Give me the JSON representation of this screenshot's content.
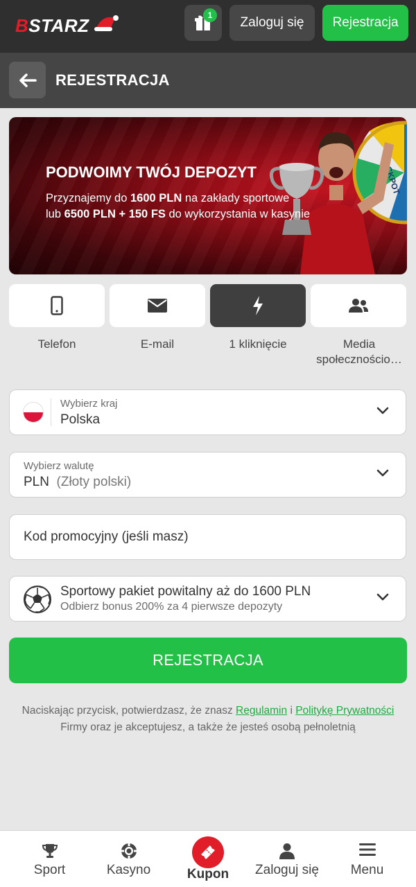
{
  "header": {
    "logo_text": "BSTARZ",
    "gift_badge": "1",
    "login_label": "Zaloguj się",
    "register_label": "Rejestracja"
  },
  "subheader": {
    "title": "REJESTRACJA"
  },
  "banner": {
    "title": "PODWOIMY TWÓJ DEPOZYT",
    "line1_pre": "Przyznajemy do ",
    "line1_bold": "1600 PLN",
    "line1_post": " na zakłady sportowe",
    "line2_pre": "lub ",
    "line2_bold": "6500 PLN + 150 FS",
    "line2_post": " do wykorzystania w kasynie",
    "wheel_text": "JACKPOT"
  },
  "methods": [
    {
      "label": "Telefon",
      "icon": "phone-icon",
      "active": false
    },
    {
      "label": "E-mail",
      "icon": "envelope-icon",
      "active": false
    },
    {
      "label": "1 kliknięcie",
      "icon": "lightning-icon",
      "active": true
    },
    {
      "label": "Media społecznościo…",
      "icon": "users-icon",
      "active": false
    }
  ],
  "form": {
    "country": {
      "label": "Wybierz kraj",
      "value": "Polska"
    },
    "currency": {
      "label": "Wybierz walutę",
      "value": "PLN",
      "value_detail": "(Złoty polski)"
    },
    "promo": {
      "placeholder": "Kod promocyjny (jeśli masz)"
    },
    "bonus": {
      "title": "Sportowy pakiet powitalny aż do 1600 PLN",
      "subtitle": "Odbierz bonus 200% za 4 pierwsze depozyty"
    },
    "submit_label": "REJESTRACJA"
  },
  "terms": {
    "pre": "Naciskając przycisk, potwierdzasz, że znasz ",
    "link1": "Regulamin",
    "mid": " i ",
    "link2": "Politykę Prywatności",
    "line2": "Firmy oraz je akceptujesz, a także że jesteś osobą pełnoletnią"
  },
  "bottom_nav": [
    {
      "label": "Sport",
      "icon": "trophy-icon"
    },
    {
      "label": "Kasyno",
      "icon": "casino-chip-icon"
    },
    {
      "label": "Kupon",
      "icon": "ticket-icon"
    },
    {
      "label": "Zaloguj się",
      "icon": "user-icon"
    },
    {
      "label": "Menu",
      "icon": "hamburger-icon"
    }
  ],
  "colors": {
    "accent_green": "#22c047",
    "accent_red": "#e11d2a",
    "topbar": "#2f2f2f",
    "subheader": "#454545"
  }
}
